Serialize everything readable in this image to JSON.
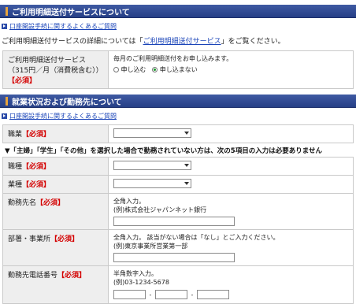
{
  "section1": {
    "title": "ご利用明細送付サービスについて",
    "faq_link": "口座開設手続に関するよくあるご質問",
    "intro_prefix": "ご利用明細送付サービスの詳細については「",
    "intro_link": "ご利用明細送付サービス",
    "intro_suffix": "」をご覧ください。",
    "row": {
      "label": "ご利用明細送付サービス（315円／月（消費税含む））",
      "required": "【必須】",
      "description": "毎月のご利用明細送付をお申し込みます。",
      "options": [
        "申し込む",
        "申し込まない"
      ],
      "selected": "申し込まない"
    }
  },
  "section2": {
    "title": "就業状況および勤務先について",
    "faq_link": "口座開設手続に関するよくあるご質問",
    "occupation": {
      "label": "職業",
      "required": "【必須】"
    },
    "notice": "▼「主婦」「学生」「その他」を選択した場合で勤務されていない方は、次の5項目の入力は必要ありません",
    "job_type": {
      "label": "職種",
      "required": "【必須】"
    },
    "industry": {
      "label": "業種",
      "required": "【必須】"
    },
    "employer": {
      "label": "勤務先名",
      "required": "【必須】",
      "hint1": "全角入力。",
      "hint2": "(例)株式会社ジャパンネット銀行"
    },
    "department": {
      "label": "部署・事業所",
      "required": "【必須】",
      "hint1": "全角入力。 該当がない場合は「なし」とご入力ください。",
      "hint2": "(例)東京事業所営業第一部"
    },
    "phone": {
      "label": "勤務先電話番号",
      "required": "【必須】",
      "hint1": "半角数字入力。",
      "hint2": "(例)03-1234-5678",
      "separator": "-"
    }
  }
}
